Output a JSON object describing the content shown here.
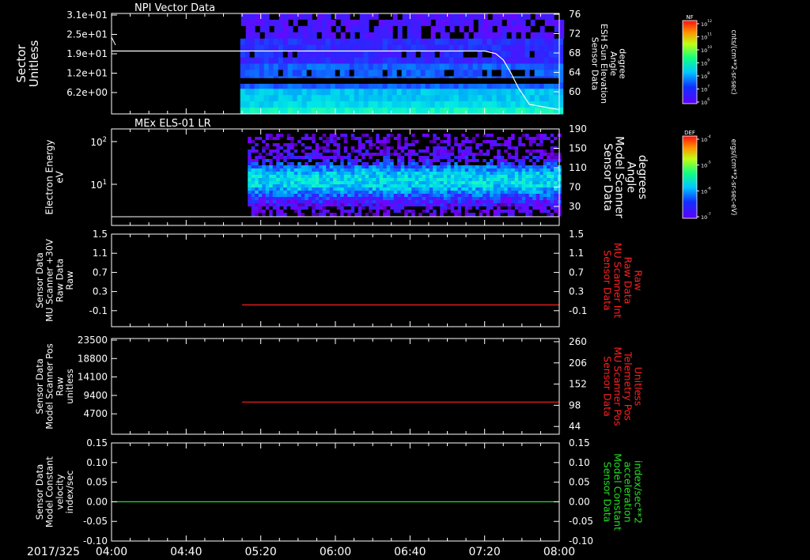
{
  "chart_data": [
    {
      "type": "heatmap",
      "title": "NPI Vector Data",
      "ylabel_lines": [
        "Sector",
        "Unitless"
      ],
      "y_ticks": [
        "3.1e+01",
        "2.5e+01",
        "1.9e+01",
        "1.2e+01",
        "6.2e+00"
      ],
      "y2label_lines": [
        "Sensor Data",
        "ESH Sun Elevation",
        "Angle",
        "degree"
      ],
      "y2_ticks": [
        "76",
        "72",
        "68",
        "64",
        "60"
      ],
      "y2_range": [
        57,
        76
      ],
      "data_start": "05:09",
      "overlay_line": {
        "x": [
          "04:00",
          "04:03",
          "07:20",
          "07:26",
          "07:30",
          "07:34",
          "07:38",
          "07:44",
          "08:00"
        ],
        "y": [
          68.9,
          68.9,
          68.9,
          68.4,
          67.2,
          64.8,
          62.0,
          58.8,
          57.8
        ]
      },
      "colorbar": {
        "label": "NF",
        "units": "cnts/(cm**2-sr-sec)",
        "ticks": [
          "10^12",
          "10^11",
          "10^10",
          "10^9",
          "10^8",
          "10^7",
          "10^6"
        ]
      }
    },
    {
      "type": "heatmap",
      "title": "MEx ELS-01 LR",
      "ylabel_lines": [
        "Electron Energy",
        "eV"
      ],
      "y_ticks": [
        "10^2",
        "10^1"
      ],
      "y2label_lines": [
        "Sensor Data",
        "Model Scanner",
        "Angle",
        "degrees"
      ],
      "y2_ticks": [
        "190",
        "150",
        "110",
        "70",
        "30"
      ],
      "y2_range": [
        0,
        190
      ],
      "data_start": "05:13",
      "overlay_line": {
        "x": [
          "04:00",
          "08:00"
        ],
        "y": [
          0,
          0
        ]
      },
      "colorbar": {
        "label": "DEF",
        "units": "ergs/(cm**2-sr-sec-eV)",
        "ticks": [
          "10^-4",
          "10^-5",
          "10^-6",
          "10^-7"
        ]
      }
    },
    {
      "type": "line",
      "ylabel_lines": [
        "Sensor Data",
        "MU Scanner +30V",
        "Raw Data",
        "Raw"
      ],
      "y_ticks": [
        "1.5",
        "1.1",
        "0.7",
        "0.3",
        "-0.1"
      ],
      "y_range": [
        -0.5,
        1.5
      ],
      "y2label_lines": [
        "Sensor Data",
        "MU Scanner Int",
        "Raw Data",
        "Raw"
      ],
      "y2_ticks": [
        "1.5",
        "1.1",
        "0.7",
        "0.3",
        "-0.1"
      ],
      "series": [
        {
          "color": "#ff2020",
          "x": [
            "05:10",
            "08:00"
          ],
          "y": [
            -0.03,
            -0.03
          ]
        }
      ]
    },
    {
      "type": "line",
      "ylabel_lines": [
        "Sensor Data",
        "Model Scanner Pos",
        "Raw",
        "unitless"
      ],
      "y_ticks": [
        "23500",
        "18800",
        "14100",
        "9400",
        "4700"
      ],
      "y_range": [
        0,
        23500
      ],
      "y2label_lines": [
        "Sensor Data",
        "MU Scanner Pos",
        "Telemetry Pos",
        "Unitless"
      ],
      "y2_ticks": [
        "260",
        "206",
        "152",
        "98",
        "44"
      ],
      "series": [
        {
          "color": "#ff2020",
          "x": [
            "05:10",
            "08:00"
          ],
          "y": [
            7900,
            7900
          ]
        }
      ]
    },
    {
      "type": "line",
      "ylabel_lines": [
        "Sensor Data",
        "Model Constant",
        "velocity",
        "index/sec"
      ],
      "y_ticks": [
        "0.15",
        "0.10",
        "0.05",
        "0.00",
        "-0.05",
        "-0.10"
      ],
      "y_range": [
        -0.1,
        0.15
      ],
      "y2label_lines": [
        "Sensor Data",
        "Model Constant",
        "acceleration",
        "index/sec**2"
      ],
      "y2_ticks": [
        "0.15",
        "0.10",
        "0.05",
        "0.00",
        "-0.05",
        "-0.10"
      ],
      "series": [
        {
          "color": "#20e020",
          "x": [
            "04:00",
            "08:00"
          ],
          "y": [
            0.0,
            0.0
          ]
        }
      ]
    }
  ],
  "x_axis": {
    "date_label": "2017/325",
    "ticks": [
      "04:00",
      "04:40",
      "05:20",
      "06:00",
      "06:40",
      "07:20",
      "08:00"
    ],
    "range": [
      "04:00",
      "08:00"
    ]
  },
  "colors": {
    "axis": "#ffffff",
    "right_label_panel3": "#ff2020",
    "right_label_panel4": "#ff2020",
    "right_label_panel5": "#20e020",
    "panel_background": "#000000"
  }
}
